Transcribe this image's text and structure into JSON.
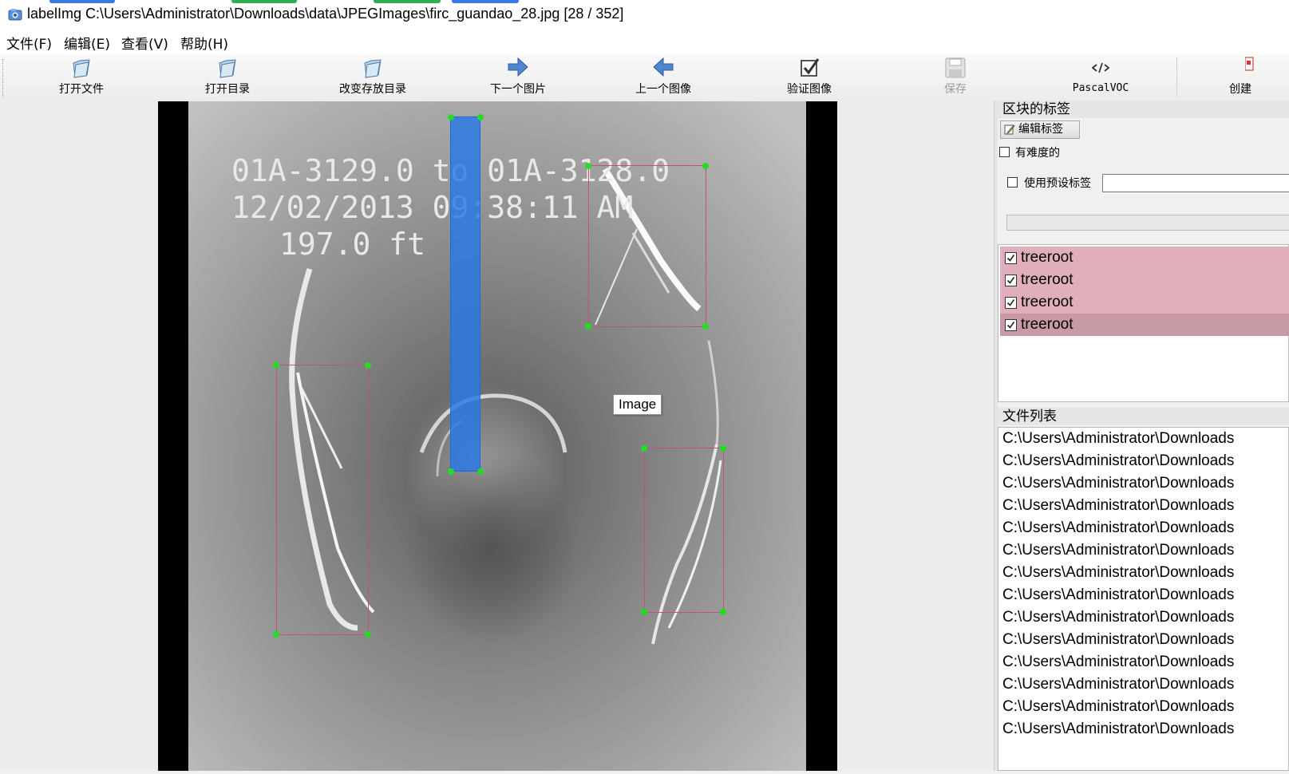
{
  "window": {
    "title": "labelImg C:\\Users\\Administrator\\Downloads\\data\\JPEGImages\\firc_guandao_28.jpg [28 / 352]"
  },
  "menu": [
    "文件(F)",
    "编辑(E)",
    "查看(V)",
    "帮助(H)"
  ],
  "toolbar": [
    {
      "label": "打开文件",
      "icon": "open-file-icon",
      "enabled": true
    },
    {
      "label": "打开目录",
      "icon": "open-dir-icon",
      "enabled": true
    },
    {
      "label": "改变存放目录",
      "icon": "change-save-dir-icon",
      "enabled": true
    },
    {
      "label": "下一个图片",
      "icon": "next-image-icon",
      "enabled": true
    },
    {
      "label": "上一个图像",
      "icon": "prev-image-icon",
      "enabled": true
    },
    {
      "label": "验证图像",
      "icon": "verify-image-icon",
      "enabled": true
    },
    {
      "label": "保存",
      "icon": "save-icon",
      "enabled": false
    },
    {
      "label": "PascalVOC",
      "icon": "format-icon",
      "enabled": true
    },
    {
      "label": "创建",
      "icon": "create-box-icon",
      "enabled": true
    }
  ],
  "canvas": {
    "tooltip": "Image",
    "overlay_text": [
      "01A-3129.0 to 01A-3128.0",
      "12/02/2013 09:38:11 AM",
      "197.0 ft"
    ]
  },
  "box_labels_panel": {
    "title": "区块的标签",
    "edit_button": "编辑标签",
    "difficult_label": "有难度的",
    "use_default_label": "使用预设标签",
    "labels": [
      "treeroot",
      "treeroot",
      "treeroot",
      "treeroot"
    ]
  },
  "file_list_panel": {
    "title": "文件列表",
    "files": [
      "C:\\Users\\Administrator\\Downloads",
      "C:\\Users\\Administrator\\Downloads",
      "C:\\Users\\Administrator\\Downloads",
      "C:\\Users\\Administrator\\Downloads",
      "C:\\Users\\Administrator\\Downloads",
      "C:\\Users\\Administrator\\Downloads",
      "C:\\Users\\Administrator\\Downloads",
      "C:\\Users\\Administrator\\Downloads",
      "C:\\Users\\Administrator\\Downloads",
      "C:\\Users\\Administrator\\Downloads",
      "C:\\Users\\Administrator\\Downloads",
      "C:\\Users\\Administrator\\Downloads",
      "C:\\Users\\Administrator\\Downloads",
      "C:\\Users\\Administrator\\Downloads"
    ]
  },
  "colors": {
    "label_row": "#e1aebb",
    "label_row_selected": "#c79aa6",
    "bbox_border": "#c2546c",
    "handle": "#22dd22",
    "highlight": "#2878e6"
  }
}
